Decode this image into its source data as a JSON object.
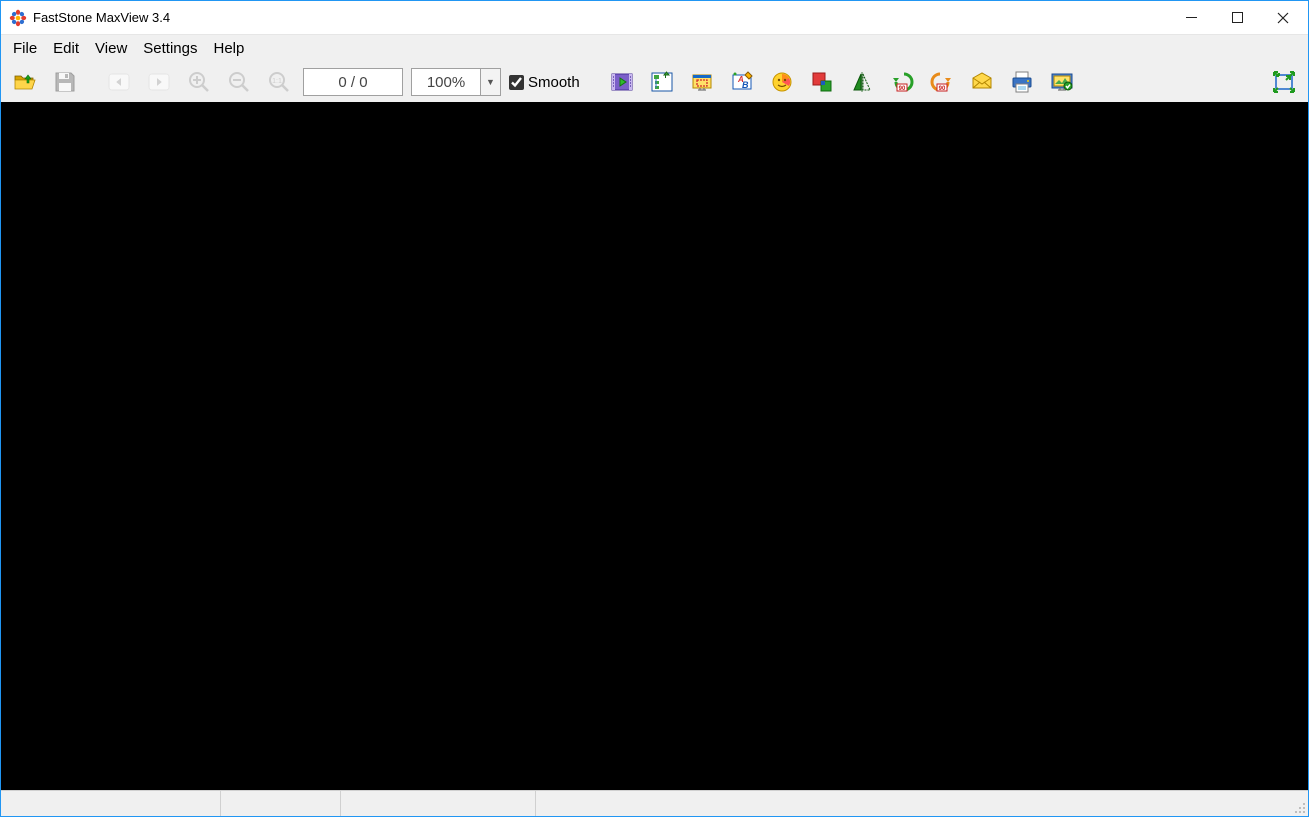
{
  "title": "FastStone MaxView 3.4",
  "menu": {
    "file": "File",
    "edit": "Edit",
    "view": "View",
    "settings": "Settings",
    "help": "Help"
  },
  "toolbar": {
    "page_counter": "0 / 0",
    "zoom": "100%",
    "smooth_label": "Smooth",
    "smooth_checked": true,
    "icons": {
      "open": "open-folder-icon",
      "save": "save-icon",
      "prev": "previous-icon",
      "next": "next-icon",
      "zoom_in": "zoom-in-icon",
      "zoom_out": "zoom-out-icon",
      "actual_size": "actual-size-icon",
      "slideshow": "slideshow-icon",
      "tree": "tree-icon",
      "screenshot": "screenshot-icon",
      "draw": "draw-board-icon",
      "colors": "colors-icon",
      "resize": "resize-icon",
      "flip": "flip-icon",
      "rotate_left": "rotate-left-icon",
      "rotate_right": "rotate-right-icon",
      "email": "email-icon",
      "print": "print-icon",
      "wallpaper": "wallpaper-icon",
      "fullscreen": "fullscreen-icon"
    }
  },
  "statusbar": {
    "p0": "",
    "p1": "",
    "p2": ""
  }
}
